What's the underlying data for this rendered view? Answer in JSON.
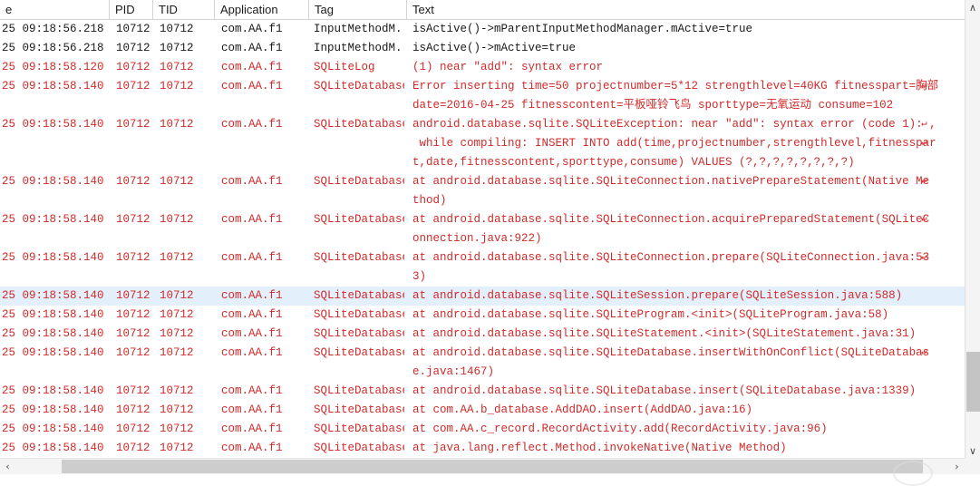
{
  "colors": {
    "error_text": "#d02a2a",
    "normal_text": "#1a1a1a",
    "selected_row": "#e3f0fb",
    "scrollbar_thumb": "#c4c4c4"
  },
  "header": {
    "columns": [
      {
        "label": "e",
        "name": "column-header-time"
      },
      {
        "label": "PID",
        "name": "column-header-pid"
      },
      {
        "label": "TID",
        "name": "column-header-tid"
      },
      {
        "label": "Application",
        "name": "column-header-application"
      },
      {
        "label": "Tag",
        "name": "column-header-tag"
      },
      {
        "label": "Text",
        "name": "column-header-text"
      }
    ]
  },
  "icons": {
    "scroll_up": "∧",
    "scroll_down": "∨",
    "scroll_left": "‹",
    "scroll_right": "›",
    "wrap_marker": "↵"
  },
  "scrollbars": {
    "vertical_thumb_top_pct": 77,
    "horizontal_thumb_left_pct": 6
  },
  "rows": [
    {
      "time": "25 09:18:56.218",
      "pid": "10712",
      "tid": "10712",
      "app": "com.AA.f1",
      "tag": "InputMethodM...",
      "text": "isActive()->mParentInputMethodManager.mActive=true",
      "error": false,
      "selected": false,
      "wrapped": false
    },
    {
      "time": "25 09:18:56.218",
      "pid": "10712",
      "tid": "10712",
      "app": "com.AA.f1",
      "tag": "InputMethodM...",
      "text": "isActive()->mActive=true",
      "error": false,
      "selected": false,
      "wrapped": false
    },
    {
      "time": "25 09:18:58.120",
      "pid": "10712",
      "tid": "10712",
      "app": "com.AA.f1",
      "tag": "SQLiteLog",
      "text": "(1) near \"add\": syntax error",
      "error": true,
      "selected": false,
      "wrapped": false
    },
    {
      "time": "25 09:18:58.140",
      "pid": "10712",
      "tid": "10712",
      "app": "com.AA.f1",
      "tag": "SQLiteDatabase",
      "text": "Error inserting time=50 projectnumber=5*12 strengthlevel=40KG fitnesspart=胸部",
      "error": true,
      "selected": false,
      "wrapped": true
    },
    {
      "time": "",
      "pid": "",
      "tid": "",
      "app": "",
      "tag": "",
      "text": "date=2016-04-25 fitnesscontent=平板哑铃飞鸟 sporttype=无氧运动 consume=102",
      "error": true,
      "selected": false,
      "wrapped": false
    },
    {
      "time": "25 09:18:58.140",
      "pid": "10712",
      "tid": "10712",
      "app": "com.AA.f1",
      "tag": "SQLiteDatabase",
      "text": "android.database.sqlite.SQLiteException: near \"add\": syntax error (code 1): ,",
      "error": true,
      "selected": false,
      "wrapped": true
    },
    {
      "time": "",
      "pid": "",
      "tid": "",
      "app": "",
      "tag": "",
      "text": " while compiling: INSERT INTO add(time,projectnumber,strengthlevel,fitnesspar",
      "error": true,
      "selected": false,
      "wrapped": true
    },
    {
      "time": "",
      "pid": "",
      "tid": "",
      "app": "",
      "tag": "",
      "text": "t,date,fitnesscontent,sporttype,consume) VALUES (?,?,?,?,?,?,?,?)",
      "error": true,
      "selected": false,
      "wrapped": false
    },
    {
      "time": "25 09:18:58.140",
      "pid": "10712",
      "tid": "10712",
      "app": "com.AA.f1",
      "tag": "SQLiteDatabase",
      "text": "at android.database.sqlite.SQLiteConnection.nativePrepareStatement(Native Me",
      "error": true,
      "selected": false,
      "wrapped": true
    },
    {
      "time": "",
      "pid": "",
      "tid": "",
      "app": "",
      "tag": "",
      "text": "thod)",
      "error": true,
      "selected": false,
      "wrapped": false
    },
    {
      "time": "25 09:18:58.140",
      "pid": "10712",
      "tid": "10712",
      "app": "com.AA.f1",
      "tag": "SQLiteDatabase",
      "text": "at android.database.sqlite.SQLiteConnection.acquirePreparedStatement(SQLiteC",
      "error": true,
      "selected": false,
      "wrapped": true
    },
    {
      "time": "",
      "pid": "",
      "tid": "",
      "app": "",
      "tag": "",
      "text": "onnection.java:922)",
      "error": true,
      "selected": false,
      "wrapped": false
    },
    {
      "time": "25 09:18:58.140",
      "pid": "10712",
      "tid": "10712",
      "app": "com.AA.f1",
      "tag": "SQLiteDatabase",
      "text": "at android.database.sqlite.SQLiteConnection.prepare(SQLiteConnection.java:53",
      "error": true,
      "selected": false,
      "wrapped": true
    },
    {
      "time": "",
      "pid": "",
      "tid": "",
      "app": "",
      "tag": "",
      "text": "3)",
      "error": true,
      "selected": false,
      "wrapped": false
    },
    {
      "time": "25 09:18:58.140",
      "pid": "10712",
      "tid": "10712",
      "app": "com.AA.f1",
      "tag": "SQLiteDatabase",
      "text": "at android.database.sqlite.SQLiteSession.prepare(SQLiteSession.java:588)",
      "error": true,
      "selected": true,
      "wrapped": false
    },
    {
      "time": "25 09:18:58.140",
      "pid": "10712",
      "tid": "10712",
      "app": "com.AA.f1",
      "tag": "SQLiteDatabase",
      "text": "at android.database.sqlite.SQLiteProgram.<init>(SQLiteProgram.java:58)",
      "error": true,
      "selected": false,
      "wrapped": false
    },
    {
      "time": "25 09:18:58.140",
      "pid": "10712",
      "tid": "10712",
      "app": "com.AA.f1",
      "tag": "SQLiteDatabase",
      "text": "at android.database.sqlite.SQLiteStatement.<init>(SQLiteStatement.java:31)",
      "error": true,
      "selected": false,
      "wrapped": false
    },
    {
      "time": "25 09:18:58.140",
      "pid": "10712",
      "tid": "10712",
      "app": "com.AA.f1",
      "tag": "SQLiteDatabase",
      "text": "at android.database.sqlite.SQLiteDatabase.insertWithOnConflict(SQLiteDatabas",
      "error": true,
      "selected": false,
      "wrapped": true
    },
    {
      "time": "",
      "pid": "",
      "tid": "",
      "app": "",
      "tag": "",
      "text": "e.java:1467)",
      "error": true,
      "selected": false,
      "wrapped": false
    },
    {
      "time": "25 09:18:58.140",
      "pid": "10712",
      "tid": "10712",
      "app": "com.AA.f1",
      "tag": "SQLiteDatabase",
      "text": "at android.database.sqlite.SQLiteDatabase.insert(SQLiteDatabase.java:1339)",
      "error": true,
      "selected": false,
      "wrapped": false
    },
    {
      "time": "25 09:18:58.140",
      "pid": "10712",
      "tid": "10712",
      "app": "com.AA.f1",
      "tag": "SQLiteDatabase",
      "text": "at com.AA.b_database.AddDAO.insert(AddDAO.java:16)",
      "error": true,
      "selected": false,
      "wrapped": false
    },
    {
      "time": "25 09:18:58.140",
      "pid": "10712",
      "tid": "10712",
      "app": "com.AA.f1",
      "tag": "SQLiteDatabase",
      "text": "at com.AA.c_record.RecordActivity.add(RecordActivity.java:96)",
      "error": true,
      "selected": false,
      "wrapped": false
    },
    {
      "time": "25 09:18:58.140",
      "pid": "10712",
      "tid": "10712",
      "app": "com.AA.f1",
      "tag": "SQLiteDatabase",
      "text": "at java.lang.reflect.Method.invokeNative(Native Method)",
      "error": true,
      "selected": false,
      "wrapped": false
    }
  ]
}
